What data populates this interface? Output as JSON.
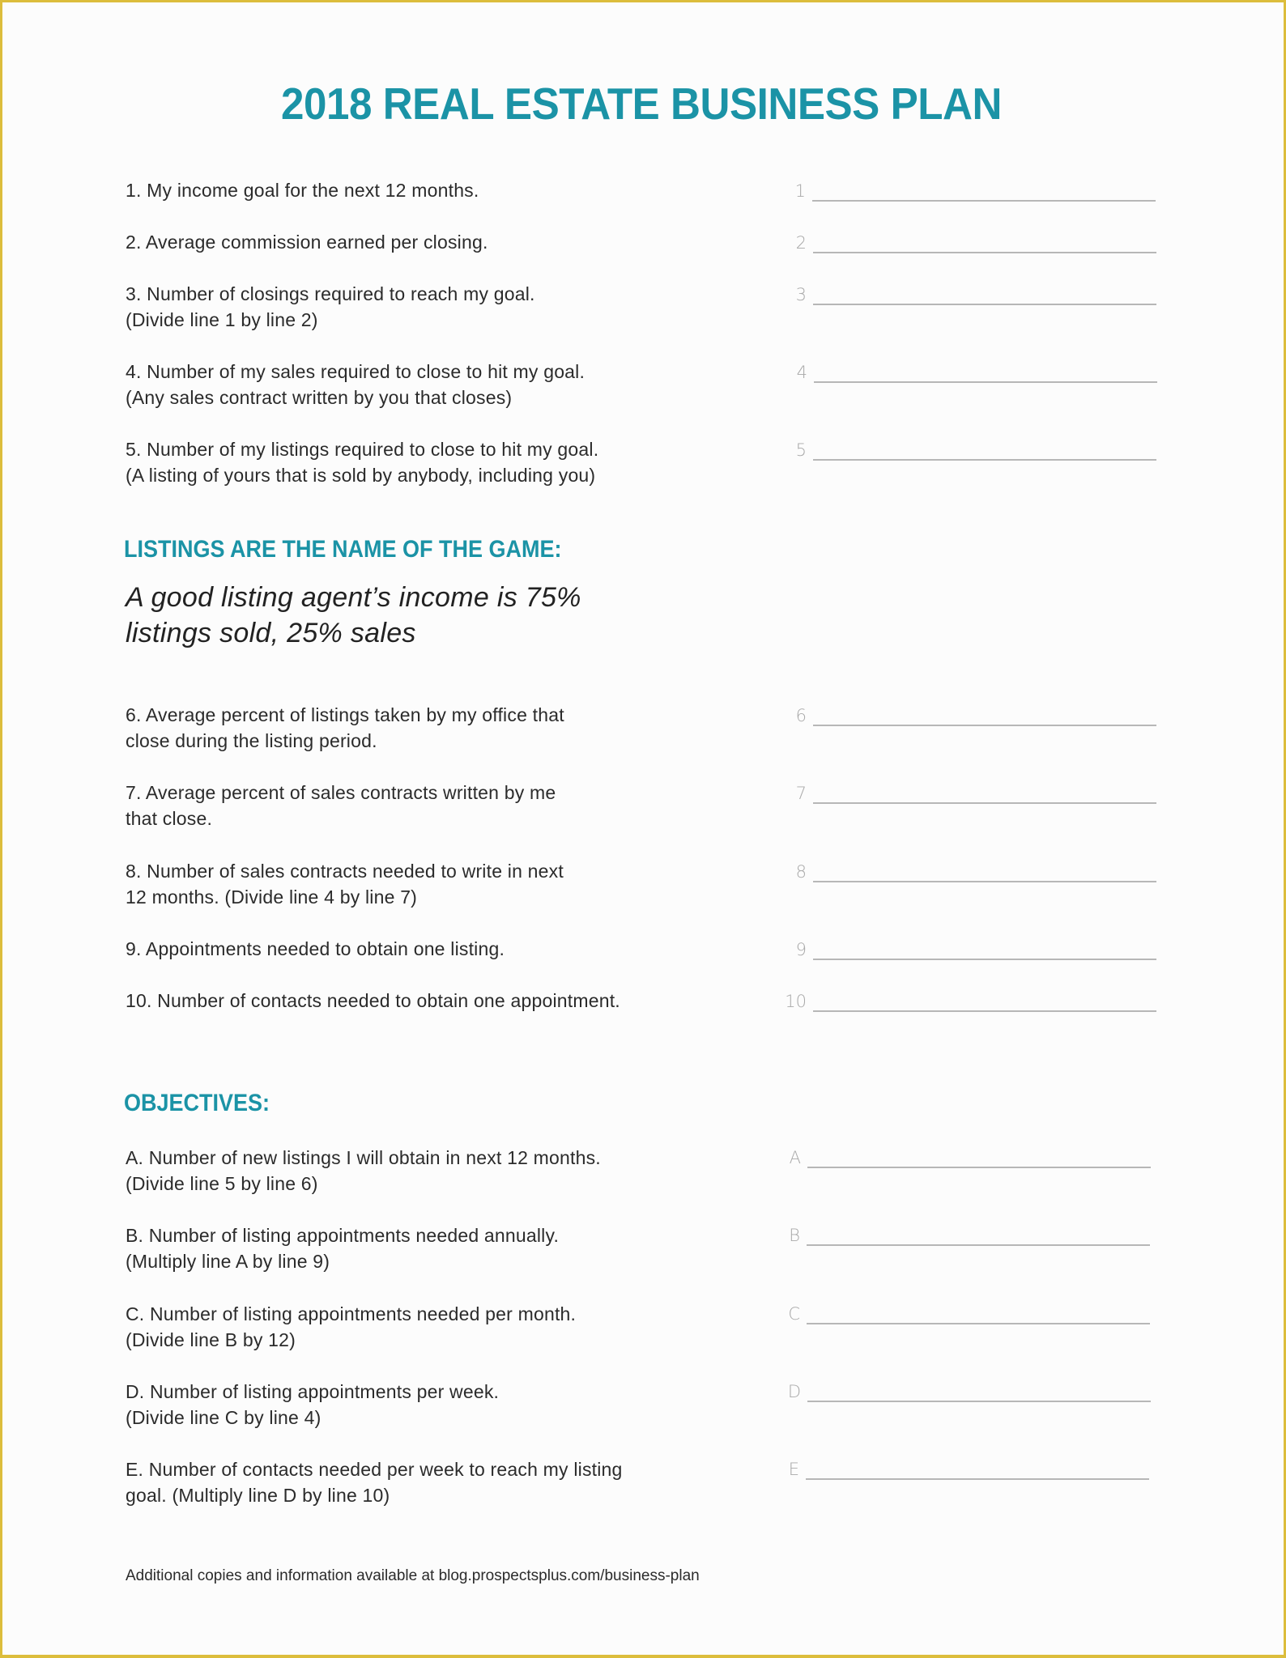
{
  "document": {
    "title": "2018 REAL ESTATE BUSINESS PLAN",
    "accent_color": "#1b93a6",
    "border_color": "#dcbd3c"
  },
  "part1": {
    "items": [
      {
        "label": "1",
        "lines": [
          "1. My income goal for the next 12 months."
        ],
        "value": ""
      },
      {
        "label": "2",
        "lines": [
          "2. Average commission earned per closing."
        ],
        "value": ""
      },
      {
        "label": "3",
        "lines": [
          "3. Number of closings required to reach my goal.",
          "(Divide line 1 by line 2)"
        ],
        "value": ""
      },
      {
        "label": "4",
        "lines": [
          "4. Number of my sales required to close to hit my goal.",
          "(Any sales contract written by you that closes)"
        ],
        "value": ""
      },
      {
        "label": "5",
        "lines": [
          "5. Number of my listings required to close to hit my goal.",
          "(A listing of yours that is sold by anybody, including you)"
        ],
        "value": ""
      }
    ]
  },
  "listings_section": {
    "heading": "LISTINGS ARE THE NAME OF THE GAME:",
    "quote_lines": [
      "A good listing agent’s income is 75%",
      "listings sold, 25% sales"
    ],
    "items": [
      {
        "label": "6",
        "lines": [
          "6. Average percent of listings taken by my office that",
          "close during the listing period."
        ],
        "value": ""
      },
      {
        "label": "7",
        "lines": [
          "7. Average percent of sales contracts written by me",
          "that close."
        ],
        "value": ""
      },
      {
        "label": "8",
        "lines": [
          "8. Number of sales contracts needed to write in next",
          "12 months. (Divide line 4 by line 7)"
        ],
        "value": ""
      },
      {
        "label": "9",
        "lines": [
          "9. Appointments needed to obtain one listing."
        ],
        "value": ""
      },
      {
        "label": "10",
        "lines": [
          "10. Number of contacts needed to obtain one appointment."
        ],
        "value": ""
      }
    ]
  },
  "objectives_section": {
    "heading": "OBJECTIVES:",
    "items": [
      {
        "label": "A",
        "lines": [
          "A. Number of new listings I will obtain in next 12 months.",
          "(Divide line 5 by line 6)"
        ],
        "value": ""
      },
      {
        "label": "B",
        "lines": [
          "B. Number of listing appointments needed annually.",
          "(Multiply line A by line 9)"
        ],
        "value": ""
      },
      {
        "label": "C",
        "lines": [
          "C. Number of listing appointments needed per month.",
          "(Divide line B by 12)"
        ],
        "value": ""
      },
      {
        "label": "D",
        "lines": [
          "D. Number of listing appointments per week.",
          "(Divide line C by line 4)"
        ],
        "value": ""
      },
      {
        "label": "E",
        "lines": [
          "E. Number of contacts needed per week to reach my listing",
          "goal. (Multiply line D by line 10)"
        ],
        "value": ""
      }
    ]
  },
  "footer": {
    "note": "Additional copies and information available at blog.prospectsplus.com/business-plan"
  }
}
